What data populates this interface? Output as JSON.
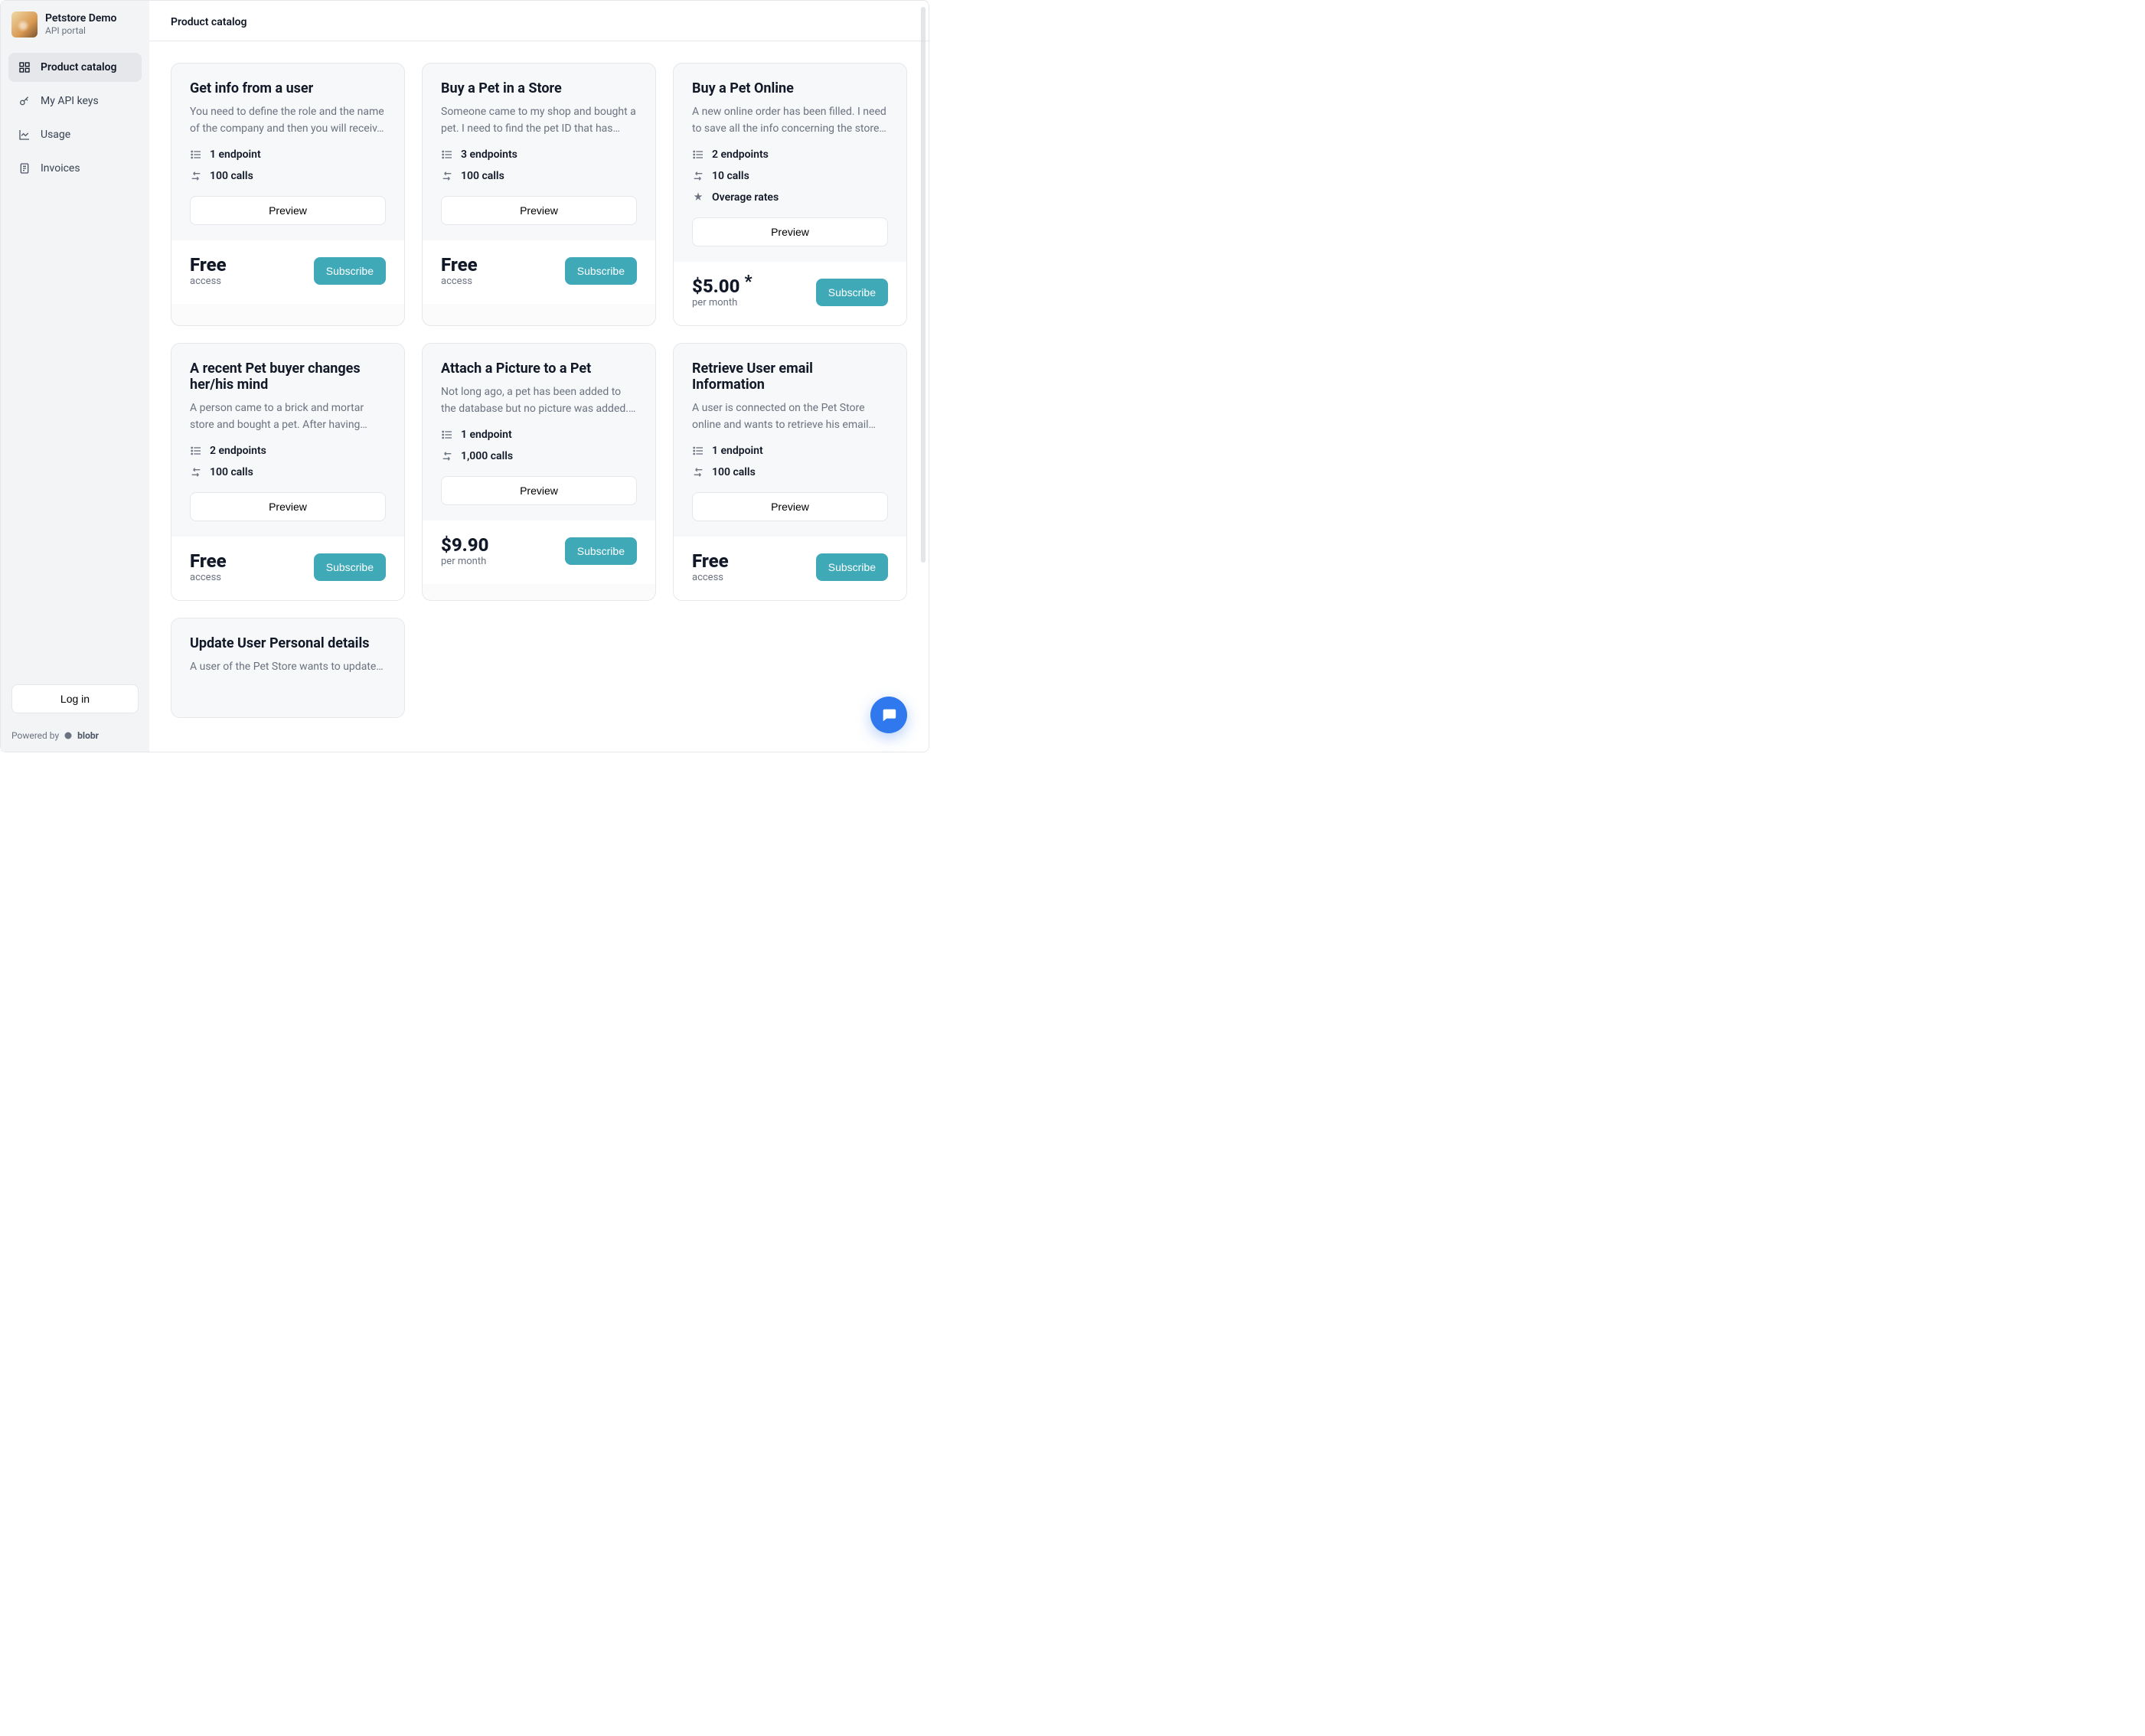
{
  "brand": {
    "title": "Petstore Demo",
    "subtitle": "API portal"
  },
  "sidebar": {
    "items": [
      {
        "label": "Product catalog",
        "active": true
      },
      {
        "label": "My API keys",
        "active": false
      },
      {
        "label": "Usage",
        "active": false
      },
      {
        "label": "Invoices",
        "active": false
      }
    ],
    "login_label": "Log in",
    "powered_prefix": "Powered by",
    "powered_brand": "blobr"
  },
  "header": {
    "title": "Product catalog"
  },
  "common": {
    "preview_label": "Preview",
    "subscribe_label": "Subscribe"
  },
  "products": [
    {
      "title": "Get info from a user",
      "desc": "You need to define the role and the name of the company and then you will receiv…",
      "endpoints": "1 endpoint",
      "calls": "100 calls",
      "overage": null,
      "price": "Free",
      "price_sub": "access",
      "price_has_star": false
    },
    {
      "title": "Buy a Pet in a Store",
      "desc": "Someone came to my shop and bought a pet. I need to find the pet ID that has…",
      "endpoints": "3 endpoints",
      "calls": "100 calls",
      "overage": null,
      "price": "Free",
      "price_sub": "access",
      "price_has_star": false
    },
    {
      "title": "Buy a Pet Online",
      "desc": "A new online order has been filled. I need to save all the info concerning the store…",
      "endpoints": "2 endpoints",
      "calls": "10 calls",
      "overage": "Overage rates",
      "price": "$5.00",
      "price_sub": "per month",
      "price_has_star": true
    },
    {
      "title": "A recent Pet buyer changes her/his mind",
      "desc": "A person came to a brick and mortar store and bought a pet. After having…",
      "endpoints": "2 endpoints",
      "calls": "100 calls",
      "overage": null,
      "price": "Free",
      "price_sub": "access",
      "price_has_star": false
    },
    {
      "title": "Attach a Picture to a Pet",
      "desc": "Not long ago, a pet has been added to the database but no picture was added.…",
      "endpoints": "1 endpoint",
      "calls": "1,000 calls",
      "overage": null,
      "price": "$9.90",
      "price_sub": "per month",
      "price_has_star": false
    },
    {
      "title": "Retrieve User email Information",
      "desc": "A user is connected on the Pet Store online and wants to retrieve his email…",
      "endpoints": "1 endpoint",
      "calls": "100 calls",
      "overage": null,
      "price": "Free",
      "price_sub": "access",
      "price_has_star": false
    },
    {
      "title": "Update User Personal details",
      "desc": "A user of the Pet Store wants to update…",
      "endpoints": "",
      "calls": "",
      "overage": null,
      "price": "",
      "price_sub": "",
      "price_has_star": false
    }
  ]
}
